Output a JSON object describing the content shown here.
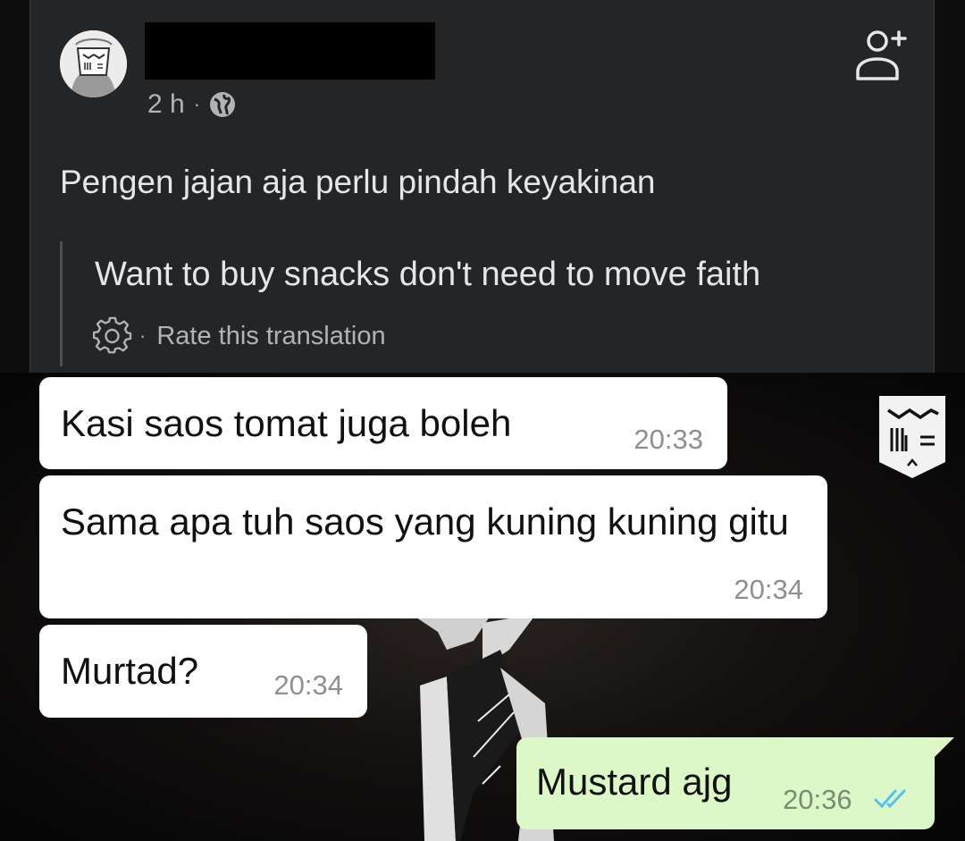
{
  "post": {
    "time": "2 h",
    "separator": "·",
    "text": "Pengen jajan aja perlu pindah keyakinan",
    "translation": "Want to buy snacks don't need to move faith",
    "rate_separator": "·",
    "rate_label": "Rate this translation"
  },
  "chat": {
    "messages": [
      {
        "text": "Kasi saos tomat juga boleh",
        "time": "20:33",
        "side": "incoming"
      },
      {
        "text": "Sama apa tuh saos yang kuning kuning gitu",
        "time": "20:34",
        "side": "incoming"
      },
      {
        "text": "Murtad?",
        "time": "20:34",
        "side": "incoming"
      },
      {
        "text": "Mustard ajg",
        "time": "20:36",
        "side": "outgoing",
        "status": "read"
      }
    ]
  },
  "colors": {
    "card_bg": "#242526",
    "primary_text": "#e4e6eb",
    "secondary_text": "#b0b3b8",
    "incoming_bubble": "#ffffff",
    "outgoing_bubble": "#dcf8c6",
    "read_ticks": "#4fc3f7"
  },
  "icons": {
    "avatar": "avatar",
    "privacy": "globe-icon",
    "add_friend": "add-friend-icon",
    "rate": "gear-icon",
    "read_receipt": "double-check-icon"
  }
}
